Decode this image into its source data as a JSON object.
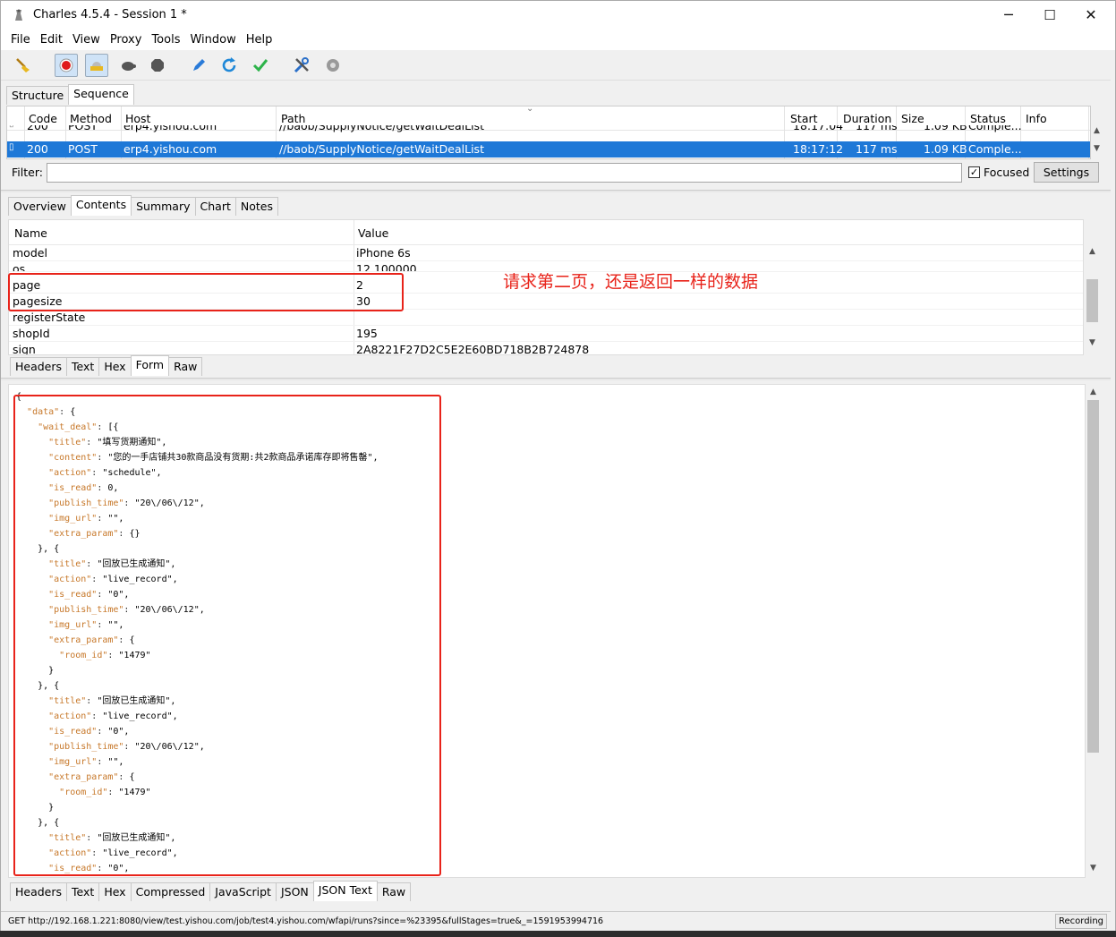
{
  "window": {
    "title": "Charles 4.5.4 - Session 1 *",
    "minimize": "─",
    "maximize": "☐",
    "close": "✕"
  },
  "menu": [
    "File",
    "Edit",
    "View",
    "Proxy",
    "Tools",
    "Window",
    "Help"
  ],
  "toolbar_icons": [
    "broom-icon",
    "record-icon",
    "throttle-icon",
    "turtle-icon",
    "stop-icon",
    "pen-icon",
    "refresh-icon",
    "check-icon",
    "tools-icon",
    "gear-icon"
  ],
  "view_tabs": [
    "Structure",
    "Sequence"
  ],
  "sequence": {
    "columns": [
      "Code",
      "Method",
      "Host",
      "Path",
      "Start",
      "Duration",
      "Size",
      "Status",
      "Info"
    ],
    "rows": [
      {
        "code": "200",
        "method": "POST",
        "host": "erp4.yishou.com",
        "path": "//baob/SupplyNotice/getWaitDealList",
        "start": "18:17:04",
        "duration": "117 ms",
        "size": "1.09 KB",
        "status": "Comple...",
        "info": ""
      },
      {
        "code": "200",
        "method": "POST",
        "host": "erp4.yishou.com",
        "path": "//baob/SupplyNotice/getWaitDealList",
        "start": "18:17:12",
        "duration": "117 ms",
        "size": "1.09 KB",
        "status": "Comple...",
        "info": ""
      }
    ]
  },
  "filter": {
    "label": "Filter:",
    "value": "",
    "focused_label": "Focused",
    "focused_checked": true,
    "settings": "Settings"
  },
  "detail_tabs": [
    "Overview",
    "Contents",
    "Summary",
    "Chart",
    "Notes"
  ],
  "form": {
    "columns": [
      "Name",
      "Value"
    ],
    "rows": [
      {
        "name": "model",
        "value": "iPhone 6s"
      },
      {
        "name": "os",
        "value": "12.100000"
      },
      {
        "name": "page",
        "value": "2"
      },
      {
        "name": "pagesize",
        "value": "30"
      },
      {
        "name": "registerState",
        "value": ""
      },
      {
        "name": "shopId",
        "value": "195"
      },
      {
        "name": "sign",
        "value": "2A8221F27D2C5E2E60BD718B2B724878"
      }
    ]
  },
  "request_tabs": [
    "Headers",
    "Text",
    "Hex",
    "Form",
    "Raw"
  ],
  "annotation": "请求第二页，还是返回一样的数据",
  "json_lines": [
    "{",
    "  \"data\": {",
    "    \"wait_deal\": [{",
    "      \"title\": \"填写货期通知\",",
    "      \"content\": \"您的一手店铺共30款商品没有货期:共2款商品承诺库存即将售罄\",",
    "      \"action\": \"schedule\",",
    "      \"is_read\": 0,",
    "      \"publish_time\": \"20\\/06\\/12\",",
    "      \"img_url\": \"\",",
    "      \"extra_param\": {}",
    "    }, {",
    "      \"title\": \"回放已生成通知\",",
    "      \"action\": \"live_record\",",
    "      \"is_read\": \"0\",",
    "      \"publish_time\": \"20\\/06\\/12\",",
    "      \"img_url\": \"\",",
    "      \"extra_param\": {",
    "        \"room_id\": \"1479\"",
    "      }",
    "    }, {",
    "      \"title\": \"回放已生成通知\",",
    "      \"action\": \"live_record\",",
    "      \"is_read\": \"0\",",
    "      \"publish_time\": \"20\\/06\\/12\",",
    "      \"img_url\": \"\",",
    "      \"extra_param\": {",
    "        \"room_id\": \"1479\"",
    "      }",
    "    }, {",
    "      \"title\": \"回放已生成通知\",",
    "      \"action\": \"live_record\",",
    "      \"is_read\": \"0\","
  ],
  "response_tabs": [
    "Headers",
    "Text",
    "Hex",
    "Compressed",
    "JavaScript",
    "JSON",
    "JSON Text",
    "Raw"
  ],
  "status": {
    "url": "GET http://192.168.1.221:8080/view/test.yishou.com/job/test4.yishou.com/wfapi/runs?since=%23395&fullStages=true&_=1591953994716",
    "recording": "Recording"
  },
  "colors": {
    "selection": "#1e78d7",
    "annotation": "#e8231a",
    "json_key": "#c7782a"
  }
}
